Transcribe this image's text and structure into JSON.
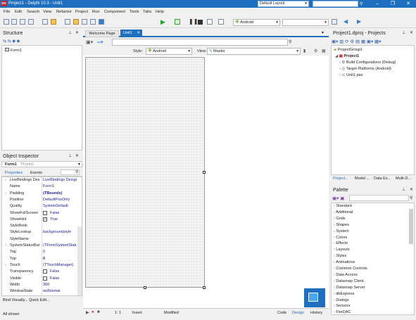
{
  "titlebar": {
    "title": "Project1 - Delphi 10.3 - Unit1",
    "logo": "DX",
    "layout": "Default Layout",
    "minimize": "–",
    "restore": "❐",
    "close": "✕"
  },
  "menu": [
    "File",
    "Edit",
    "Search",
    "View",
    "Refactor",
    "Project",
    "Run",
    "Component",
    "Tools",
    "Tabs",
    "Help"
  ],
  "toolbar": {
    "platform": "Android"
  },
  "structure": {
    "title": "Structure",
    "item": "Form1"
  },
  "editor_tabs": {
    "welcome": "Welcome Page",
    "unit": "Unit1"
  },
  "designer": {
    "style_label": "Style:",
    "style_value": "Android",
    "view_label": "View:",
    "view_value": "Master"
  },
  "status": {
    "position": "1: 1",
    "mode": "Insert",
    "state": "Modified"
  },
  "bottom_tabs": [
    "Code",
    "Design",
    "History"
  ],
  "inspector": {
    "title": "Object Inspector",
    "object": "Form1",
    "object_type": "TForm1",
    "tabs": [
      "Properties",
      "Events"
    ],
    "rows": [
      {
        "name": "LiveBindings Des",
        "value": "LiveBindings Design"
      },
      {
        "name": "Name",
        "value": "Form1"
      },
      {
        "name": "Padding",
        "value": "(TBounds)"
      },
      {
        "name": "Position",
        "value": "DefaultPosOnly"
      },
      {
        "name": "Quality",
        "value": "SystemDefault"
      },
      {
        "name": "ShowFullScreen",
        "value": "False"
      },
      {
        "name": "ShowHint",
        "value": "True"
      },
      {
        "name": "StyleBook",
        "value": ""
      },
      {
        "name": "StyleLookup",
        "value": "backgroundstyle"
      },
      {
        "name": "StyleName",
        "value": ""
      },
      {
        "name": "SystemStatusBar",
        "value": "(TFormSystemStatu"
      },
      {
        "name": "Tag",
        "value": "0"
      },
      {
        "name": "Top",
        "value": "0"
      },
      {
        "name": "Touch",
        "value": "(TTouchManager)"
      },
      {
        "name": "Transparency",
        "value": "False"
      },
      {
        "name": "Visible",
        "value": "False"
      },
      {
        "name": "Width",
        "value": "360"
      },
      {
        "name": "WindowState",
        "value": "wsNormal"
      }
    ],
    "links": "Bind Visually...  Quick Edit...",
    "filter": "All shown"
  },
  "project": {
    "title": "Project1.dproj - Projects",
    "items": [
      "ProjectGroup1",
      "Project1",
      "Build Configurations (Debug)",
      "Target Platforms (Android)",
      "Unit1.pas"
    ],
    "tabs": [
      "Project...",
      "Model ...",
      "Data Ex...",
      "Multi-D..."
    ]
  },
  "palette": {
    "title": "Palette",
    "items": [
      "Standard",
      "Additional",
      "Grids",
      "Shapes",
      "System",
      "Colors",
      "Effects",
      "Layouts",
      "Styles",
      "Animations",
      "Common Controls",
      "Data Access",
      "Datasnap Client",
      "Datasnap Server",
      "dbExpress",
      "Dialogs",
      "Sensors",
      "FireDAC"
    ]
  },
  "colors": {
    "titlebar": "#1e6fbf",
    "accent": "#1e6fbf",
    "selected": "#cde4f7"
  }
}
